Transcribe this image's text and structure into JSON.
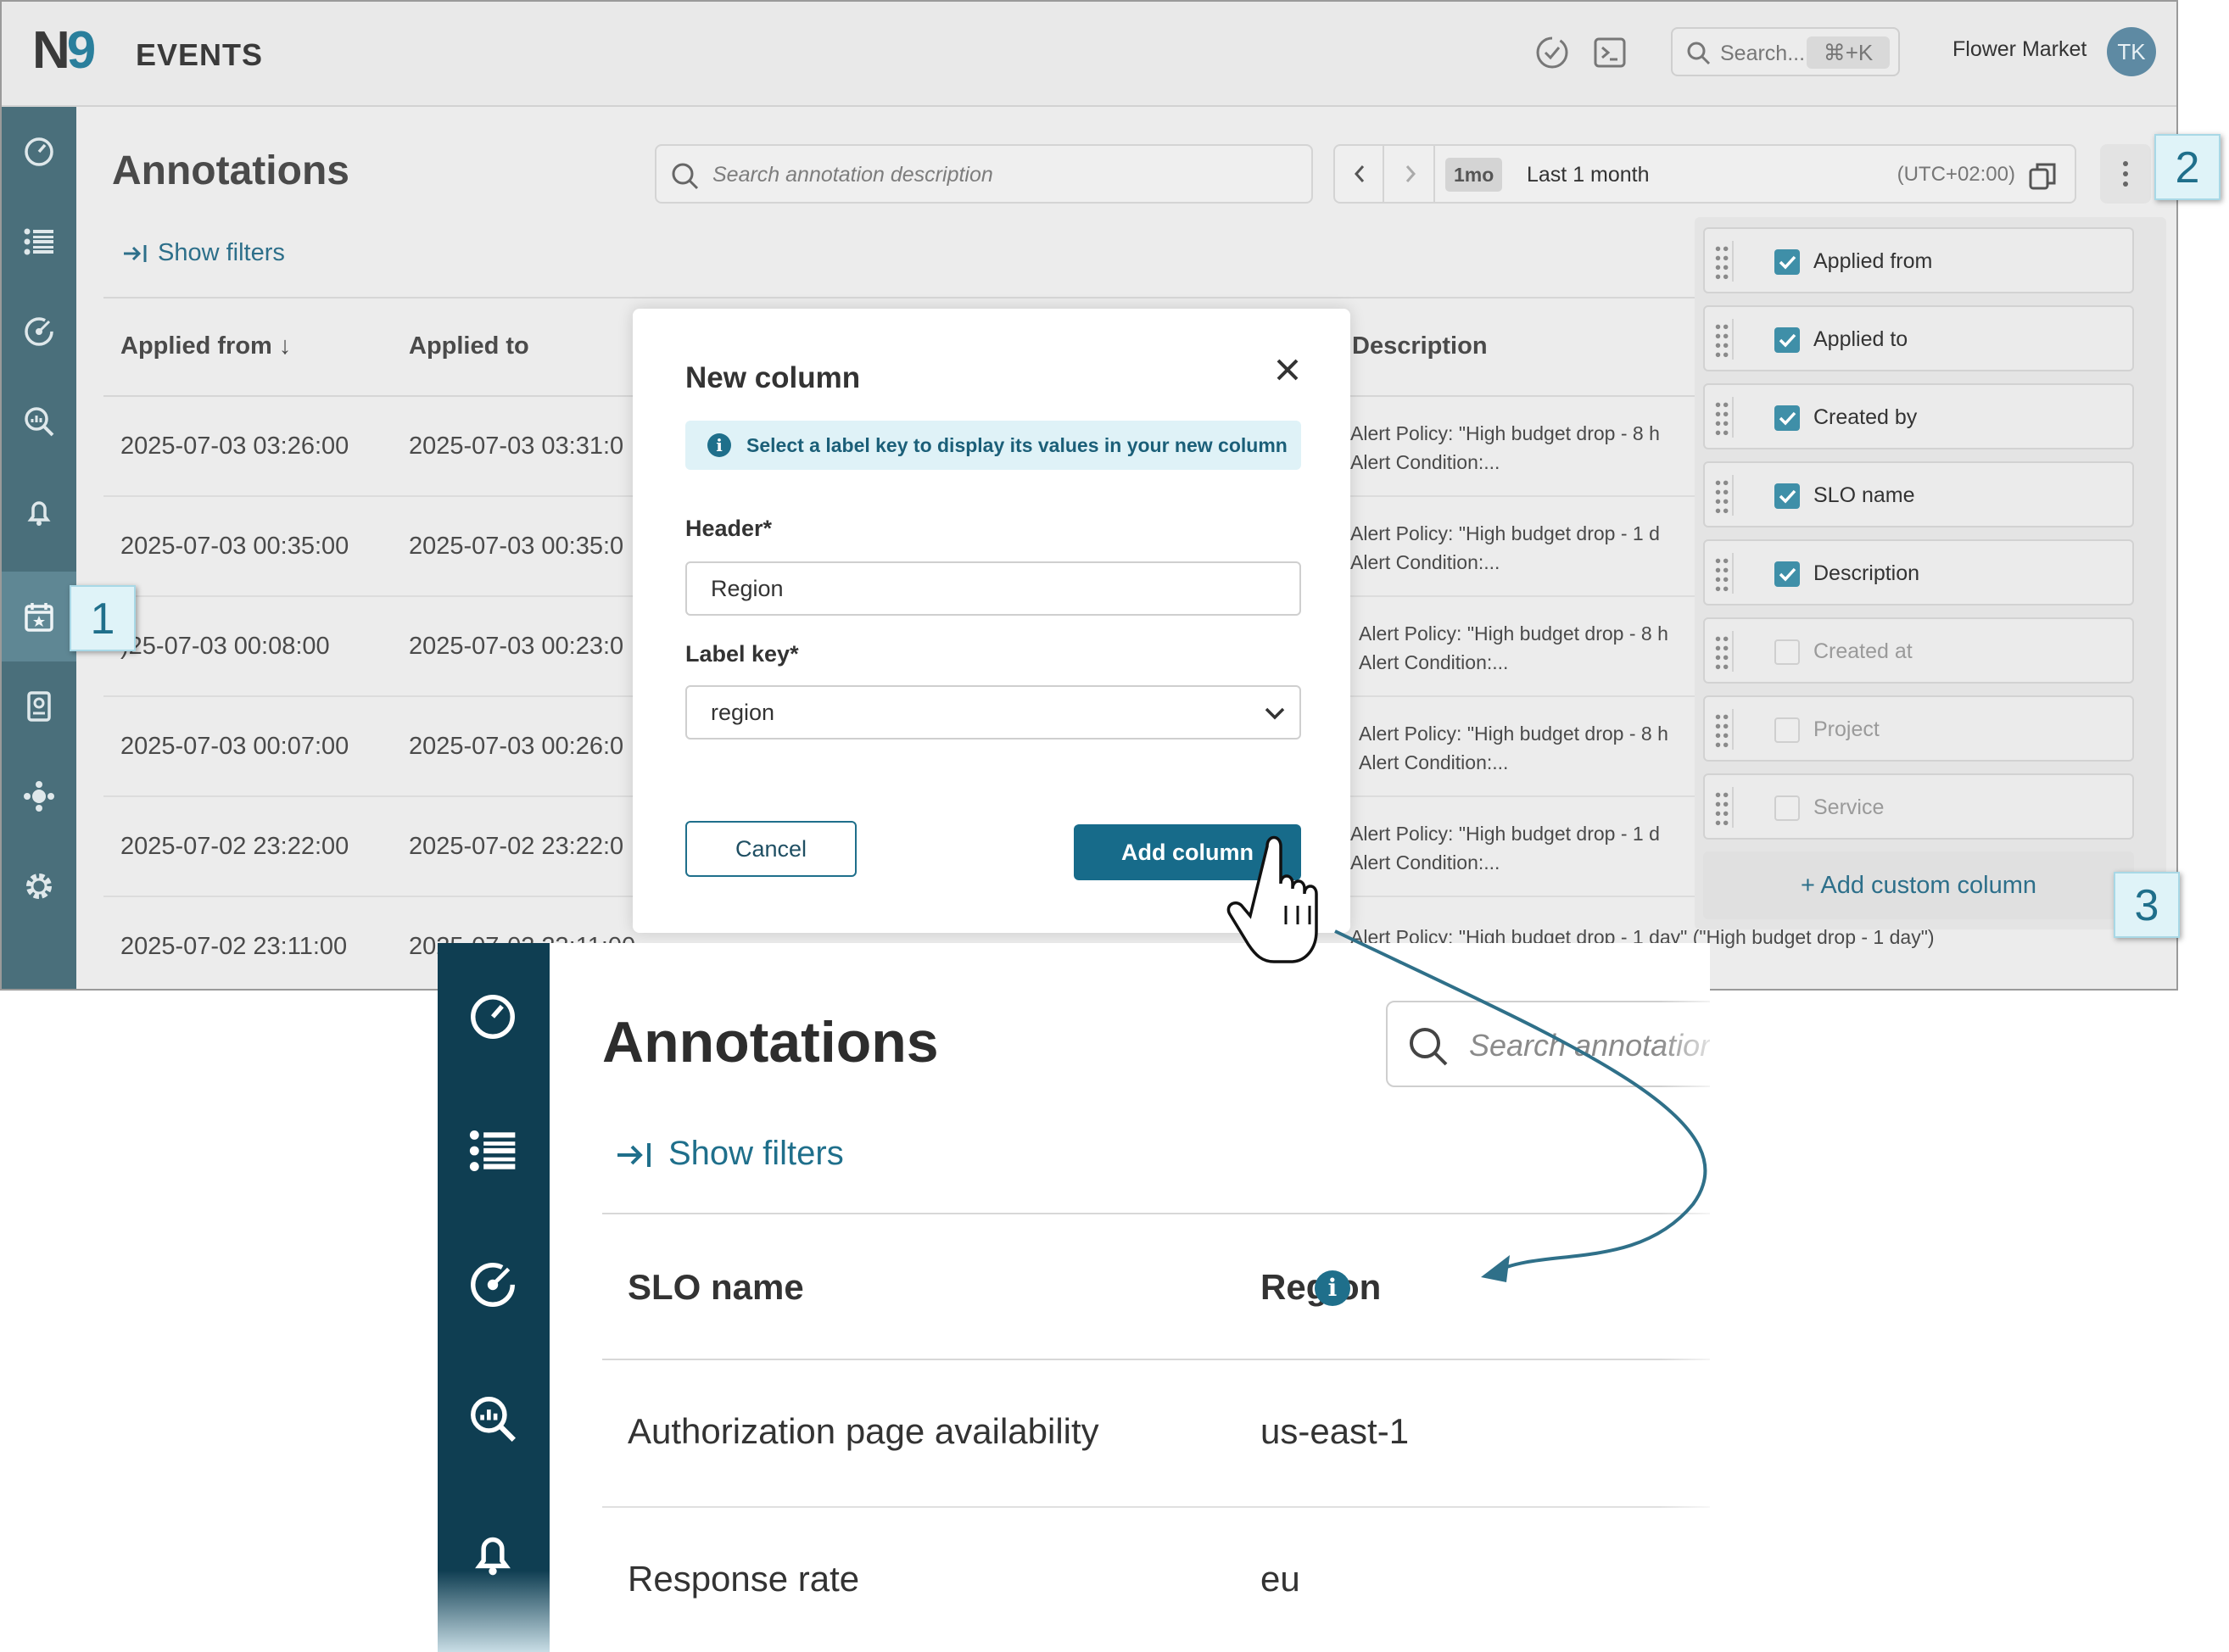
{
  "app": {
    "logo_n": "N",
    "logo_nine": "9",
    "name": "EVENTS",
    "search_placeholder": "Search...",
    "search_shortcut": "⌘+K",
    "workspace": "Flower Market",
    "avatar_initials": "TK"
  },
  "page": {
    "title": "Annotations",
    "search_placeholder": "Search annotation description",
    "time_badge": "1mo",
    "time_range": "Last 1 month",
    "timezone": "(UTC+02:00)",
    "show_filters": "Show filters"
  },
  "table": {
    "headers": {
      "applied_from": "Applied from ↓",
      "applied_to": "Applied to",
      "description": "Description"
    },
    "rows": [
      {
        "from": "2025-07-03 03:26:00",
        "to": "2025-07-03 03:31:0",
        "desc1": "Alert Policy: \"High budget drop - 8 h",
        "desc2": "Alert Condition:..."
      },
      {
        "from": "2025-07-03 00:35:00",
        "to": "2025-07-03 00:35:0",
        "desc1": "Alert Policy: \"High budget drop - 1 d",
        "desc2": "Alert Condition:..."
      },
      {
        "from": ")25-07-03 00:08:00",
        "to": "2025-07-03 00:23:0",
        "desc1": "Alert Policy: \"High budget drop - 8 h",
        "desc2": "Alert Condition:..."
      },
      {
        "from": "2025-07-03 00:07:00",
        "to": "2025-07-03 00:26:0",
        "desc1": "Alert Policy: \"High budget drop - 8 h",
        "desc2": "Alert Condition:..."
      },
      {
        "from": "2025-07-02 23:22:00",
        "to": "2025-07-02 23:22:0",
        "desc1": "Alert Policy: \"High budget drop - 1 d",
        "desc2": "Alert Condition:..."
      },
      {
        "from": "2025-07-02 23:11:00",
        "to": "2025-07-02 23:11:00",
        "desc1": "Alert Policy: \"High budget drop - 1 day\" (\"High budget drop - 1 day\")",
        "desc2": ""
      }
    ]
  },
  "dialog": {
    "title": "New column",
    "info": "Select a label key to display its values in your new column",
    "header_label": "Header*",
    "header_value": "Region",
    "label_key_label": "Label key*",
    "label_key_value": "region",
    "cancel": "Cancel",
    "add": "Add column"
  },
  "columns_panel": {
    "items": [
      {
        "label": "Applied from",
        "checked": true
      },
      {
        "label": "Applied to",
        "checked": true
      },
      {
        "label": "Created by",
        "checked": true
      },
      {
        "label": "SLO name",
        "checked": true
      },
      {
        "label": "Description",
        "checked": true
      },
      {
        "label": "Created at",
        "checked": false
      },
      {
        "label": "Project",
        "checked": false
      },
      {
        "label": "Service",
        "checked": false
      }
    ],
    "add_custom": "+ Add custom column"
  },
  "callouts": {
    "one": "1",
    "two": "2",
    "three": "3"
  },
  "zoom": {
    "title": "Annotations",
    "search_placeholder": "Search annotatior",
    "show_filters": "Show filters",
    "headers": {
      "slo_name": "SLO name",
      "region": "Region",
      "info": "i"
    },
    "rows": [
      {
        "slo": "Authorization page availability",
        "region": "us-east-1"
      },
      {
        "slo": "Response rate",
        "region": "eu"
      }
    ]
  },
  "colors": {
    "accent": "#176b8a",
    "nav_dark": "#0f3e52",
    "nav_dim": "#4a6f7b",
    "callout_bg": "#dff3f8"
  }
}
